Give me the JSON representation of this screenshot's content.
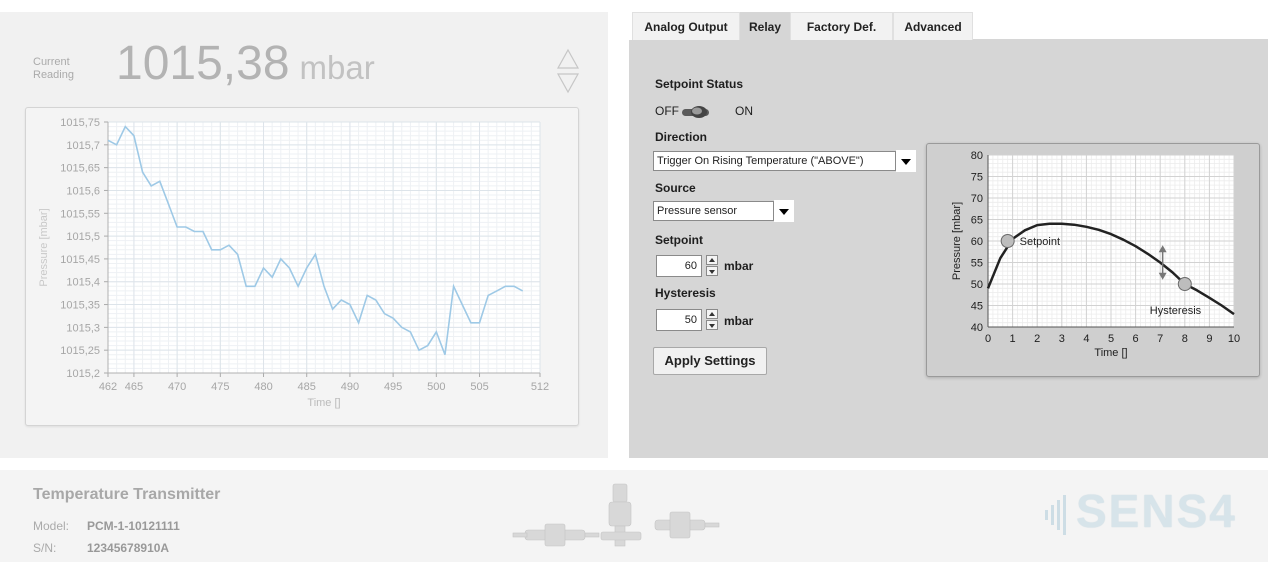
{
  "current_reading": {
    "label": "Current Reading",
    "value": "1015,38",
    "unit": "mbar"
  },
  "tabs": [
    {
      "label": "Analog Output",
      "active": false
    },
    {
      "label": "Relay",
      "active": true
    },
    {
      "label": "Factory Def.",
      "active": false
    },
    {
      "label": "Advanced",
      "active": false
    }
  ],
  "relay": {
    "setpoint_status_label": "Setpoint Status",
    "off_label": "OFF",
    "on_label": "ON",
    "toggle_state": "OFF",
    "direction_label": "Direction",
    "direction_value": "Trigger On Rising Temperature (\"ABOVE\")",
    "source_label": "Source",
    "source_value": "Pressure sensor",
    "setpoint_label": "Setpoint",
    "setpoint_value": "60",
    "setpoint_unit": "mbar",
    "hysteresis_label": "Hysteresis",
    "hysteresis_value": "50",
    "hysteresis_unit": "mbar",
    "apply_label": "Apply Settings"
  },
  "footer": {
    "product": "Temperature Transmitter",
    "model_key": "Model:",
    "model_value": "PCM-1-10121111",
    "sn_key": "S/N:",
    "sn_value": "12345678910A",
    "logo_text": "SENS4"
  },
  "colors": {
    "panel_bg": "#f1f1f1",
    "relay_panel_bg": "#d6d6d6",
    "trend_line": "#9ec9e6",
    "relay_curve": "#222222",
    "logo": "#d7e4ea"
  },
  "icons": {
    "up_down": "up-down-triangles-icon",
    "dropdown": "caret-down-icon",
    "spinner": "spinner-icon"
  },
  "chart_data": [
    {
      "type": "line",
      "ylabel": "Pressure [mbar]",
      "xlabel": "Time []",
      "xlim": [
        462,
        512
      ],
      "ylim": [
        1015.2,
        1015.75
      ],
      "x_ticks": [
        462,
        465,
        470,
        475,
        480,
        485,
        490,
        495,
        500,
        505,
        512
      ],
      "y_ticks": [
        "1015,75",
        "1015,7",
        "1015,65",
        "1015,6",
        "1015,55",
        "1015,5",
        "1015,45",
        "1015,4",
        "1015,35",
        "1015,3",
        "1015,25",
        "1015,2"
      ],
      "grid": true,
      "series": [
        {
          "x": [
            462,
            463,
            464,
            465,
            466,
            467,
            468,
            469,
            470,
            471,
            472,
            473,
            474,
            475,
            476,
            477,
            478,
            479,
            480,
            481,
            482,
            483,
            484,
            485,
            486,
            487,
            488,
            489,
            490,
            491,
            492,
            493,
            494,
            495,
            496,
            497,
            498,
            499,
            500,
            501,
            502,
            503,
            504,
            505,
            506,
            507,
            508,
            509,
            510
          ],
          "values": [
            1015.71,
            1015.7,
            1015.74,
            1015.72,
            1015.64,
            1015.61,
            1015.62,
            1015.57,
            1015.52,
            1015.52,
            1015.51,
            1015.51,
            1015.47,
            1015.47,
            1015.48,
            1015.46,
            1015.39,
            1015.39,
            1015.43,
            1015.41,
            1015.45,
            1015.43,
            1015.39,
            1015.43,
            1015.46,
            1015.39,
            1015.34,
            1015.36,
            1015.35,
            1015.31,
            1015.37,
            1015.36,
            1015.33,
            1015.32,
            1015.3,
            1015.29,
            1015.25,
            1015.26,
            1015.29,
            1015.24,
            1015.39,
            1015.35,
            1015.31,
            1015.31,
            1015.37,
            1015.38,
            1015.39,
            1015.39,
            1015.38
          ]
        }
      ]
    },
    {
      "type": "line",
      "ylabel": "Pressure [mbar]",
      "xlabel": "Time []",
      "xlim": [
        0,
        10
      ],
      "ylim": [
        40,
        80
      ],
      "x_ticks": [
        0,
        1,
        2,
        3,
        4,
        5,
        6,
        7,
        8,
        9,
        10
      ],
      "y_ticks": [
        80,
        75,
        70,
        65,
        60,
        55,
        50,
        45,
        40
      ],
      "grid": true,
      "series": [
        {
          "x": [
            0,
            0.5,
            1,
            1.5,
            2,
            2.5,
            3,
            3.5,
            4,
            4.5,
            5,
            5.5,
            6,
            6.5,
            7,
            7.5,
            8,
            8.5,
            9,
            9.5,
            10
          ],
          "values": [
            49,
            56,
            60.5,
            62.5,
            63.7,
            64,
            64,
            63.8,
            63.3,
            62.6,
            61.6,
            60.3,
            58.8,
            57,
            55,
            52.7,
            50,
            48.5,
            46.8,
            45,
            43
          ]
        }
      ],
      "annotations": [
        {
          "label": "Setpoint",
          "x": 0.8,
          "y": 60
        },
        {
          "label": "Hysteresis",
          "x": 8,
          "y": 50
        }
      ]
    }
  ]
}
